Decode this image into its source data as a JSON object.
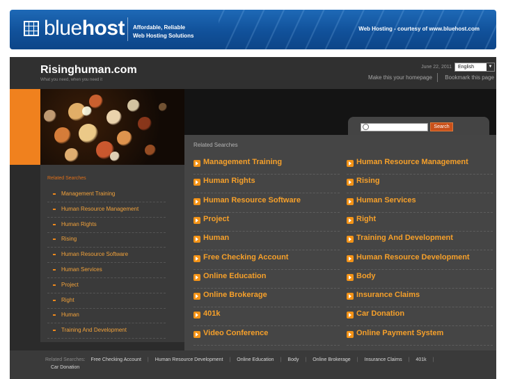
{
  "banner": {
    "logo_light": "blue",
    "logo_bold": "host",
    "tagline_1": "Affordable, Reliable",
    "tagline_2": "Web Hosting Solutions",
    "courtesy": "Web Hosting - courtesy of www.bluehost.com"
  },
  "header": {
    "title": "Risinghuman.com",
    "subtitle": "What you need, when you need it",
    "date": "June 22, 2011",
    "language": "English",
    "make_homepage": "Make this your homepage",
    "bookmark": "Bookmark this page"
  },
  "search": {
    "placeholder": "",
    "button": "Search"
  },
  "left": {
    "heading": "Related Searches",
    "items": [
      "Management Training",
      "Human Resource Management",
      "Human Rights",
      "Rising",
      "Human Resource Software",
      "Human Services",
      "Project",
      "Right",
      "Human",
      "Training And Development"
    ]
  },
  "right": {
    "heading": "Related Searches",
    "col1": [
      "Management Training",
      "Human Rights",
      "Human Resource Software",
      "Project",
      "Human",
      "Free Checking Account",
      "Online Education",
      "Online Brokerage",
      "401k",
      "Video Conference"
    ],
    "col2": [
      "Human Resource Management",
      "Rising",
      "Human Services",
      "Right",
      "Training And Development",
      "Human Resource Development",
      "Body",
      "Insurance Claims",
      "Car Donation",
      "Online Payment System"
    ]
  },
  "footer": {
    "heading": "Related Searches:",
    "links": [
      "Free Checking Account",
      "Human Resource Development",
      "Online Education",
      "Body",
      "Online Brokerage",
      "Insurance Claims",
      "401k",
      "Car Donation"
    ]
  },
  "colors": {
    "accent_orange": "#f0811e",
    "banner_blue": "#1a5fa8",
    "link_orange": "#f6a02a"
  }
}
